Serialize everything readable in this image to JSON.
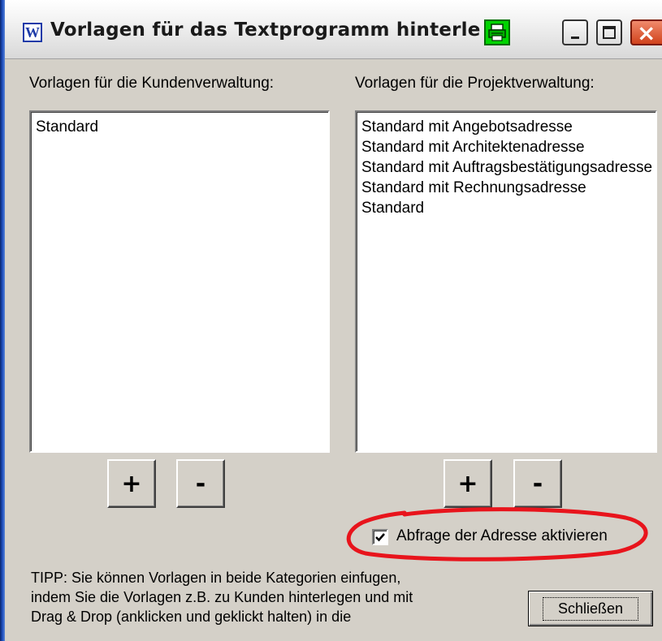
{
  "window": {
    "title": "Vorlagen für das Textprogramm hinterlege"
  },
  "icons": {
    "app": "word-w-icon",
    "printer": "printer-icon"
  },
  "app_icon_letter": "W",
  "left_panel": {
    "label": "Vorlagen für die Kundenverwaltung:",
    "items": [
      "Standard"
    ],
    "add_label": "+",
    "remove_label": "-"
  },
  "right_panel": {
    "label": "Vorlagen für die Projektverwaltung:",
    "items": [
      "Standard mit Angebotsadresse",
      "Standard mit Architektenadresse",
      "Standard mit Auftragsbestätigungsadresse",
      "Standard mit Rechnungsadresse",
      "Standard"
    ],
    "add_label": "+",
    "remove_label": "-"
  },
  "checkbox": {
    "label": "Abfrage der Adresse aktivieren",
    "checked": true
  },
  "tipp": {
    "line1": "TIPP: Sie können Vorlagen in beide Kategorien einfugen,",
    "line2": "indem Sie die Vorlagen z.B. zu Kunden hinterlegen und mit",
    "line3": "Drag & Drop (anklicken und geklickt halten) in die"
  },
  "close_button": {
    "label": "Schließen"
  },
  "colors": {
    "annotation": "#e8141c",
    "printer_icon": "#00d400",
    "dialog_bg": "#d4d0c8"
  }
}
